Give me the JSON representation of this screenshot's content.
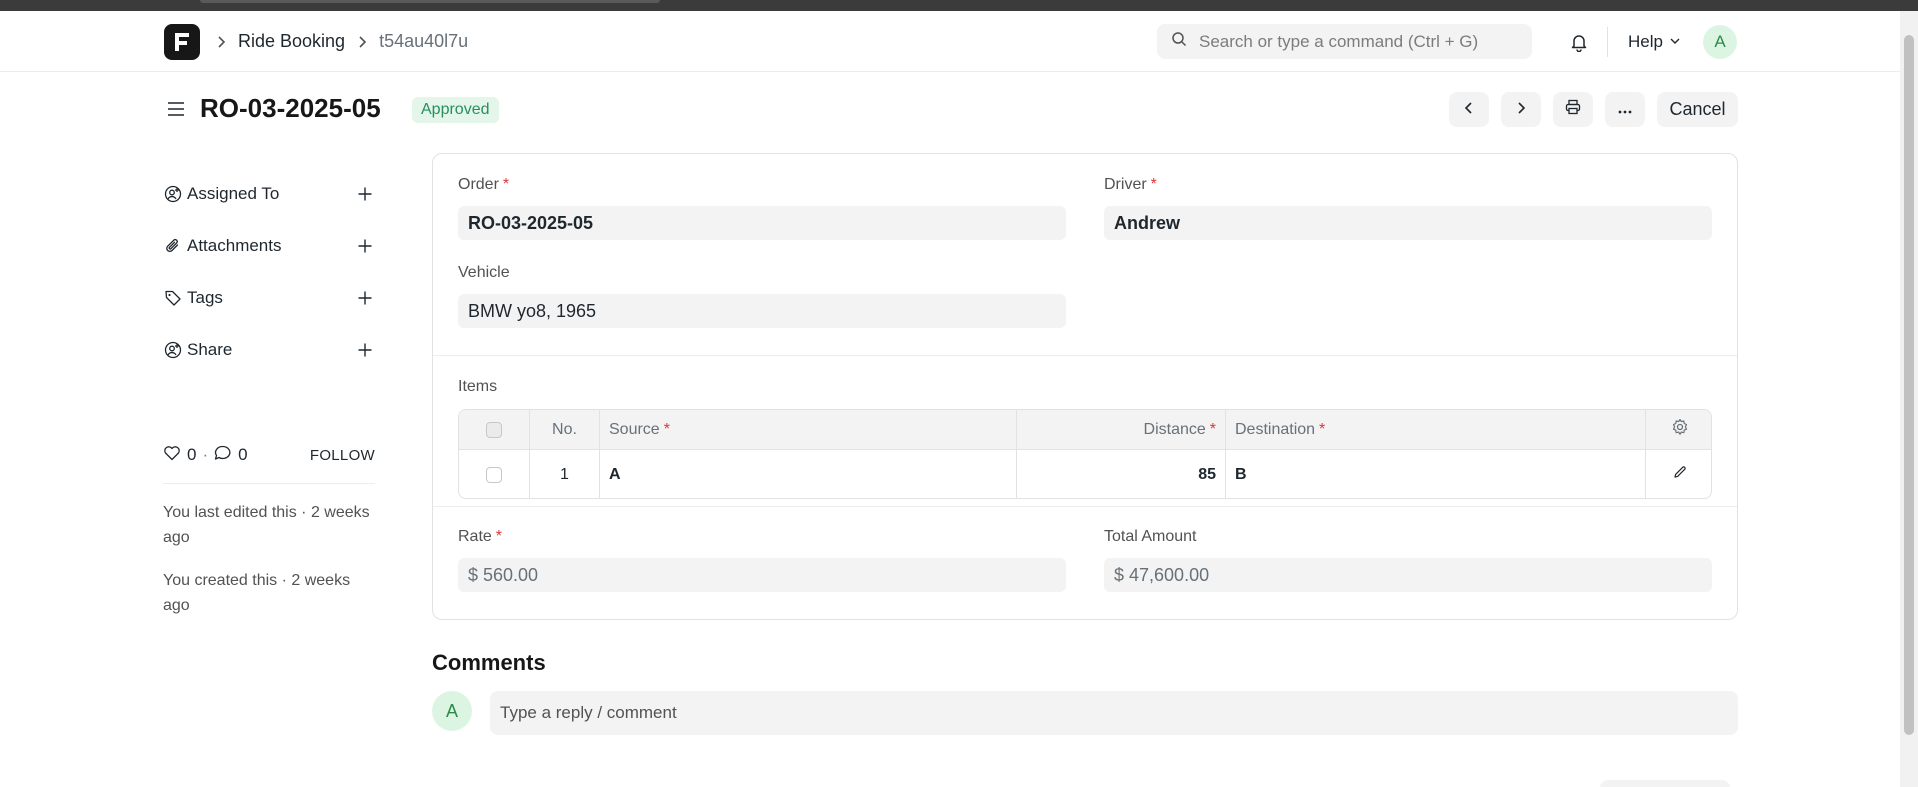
{
  "breadcrumbs": [
    "Ride Booking",
    "t54au40l7u"
  ],
  "search": {
    "placeholder": "Search or type a command (Ctrl + G)"
  },
  "help_label": "Help",
  "user_initial": "A",
  "doc": {
    "title": "RO-03-2025-05",
    "status": "Approved",
    "cancel_label": "Cancel"
  },
  "sidebar": {
    "items": [
      {
        "label": "Assigned To",
        "icon": "user-add-icon"
      },
      {
        "label": "Attachments",
        "icon": "paperclip-icon"
      },
      {
        "label": "Tags",
        "icon": "tag-icon"
      },
      {
        "label": "Share",
        "icon": "share-user-icon"
      }
    ],
    "likes": "0",
    "comments_count": "0",
    "follow_label": "FOLLOW",
    "last_edited": "You last edited this · 2 weeks ago",
    "created": "You created this · 2 weeks ago"
  },
  "form": {
    "order_label": "Order",
    "order_value": "RO-03-2025-05",
    "driver_label": "Driver",
    "driver_value": "Andrew",
    "vehicle_label": "Vehicle",
    "vehicle_value": "BMW yo8, 1965",
    "items_label": "Items",
    "columns": {
      "no": "No.",
      "source": "Source",
      "distance": "Distance",
      "destination": "Destination"
    },
    "rows": [
      {
        "no": "1",
        "source": "A",
        "distance": "85",
        "destination": "B"
      }
    ],
    "rate_label": "Rate",
    "rate_value": "$ 560.00",
    "total_label": "Total Amount",
    "total_value": "$ 47,600.00"
  },
  "comments": {
    "title": "Comments",
    "placeholder": "Type a reply / comment",
    "avatar_initial": "A"
  }
}
